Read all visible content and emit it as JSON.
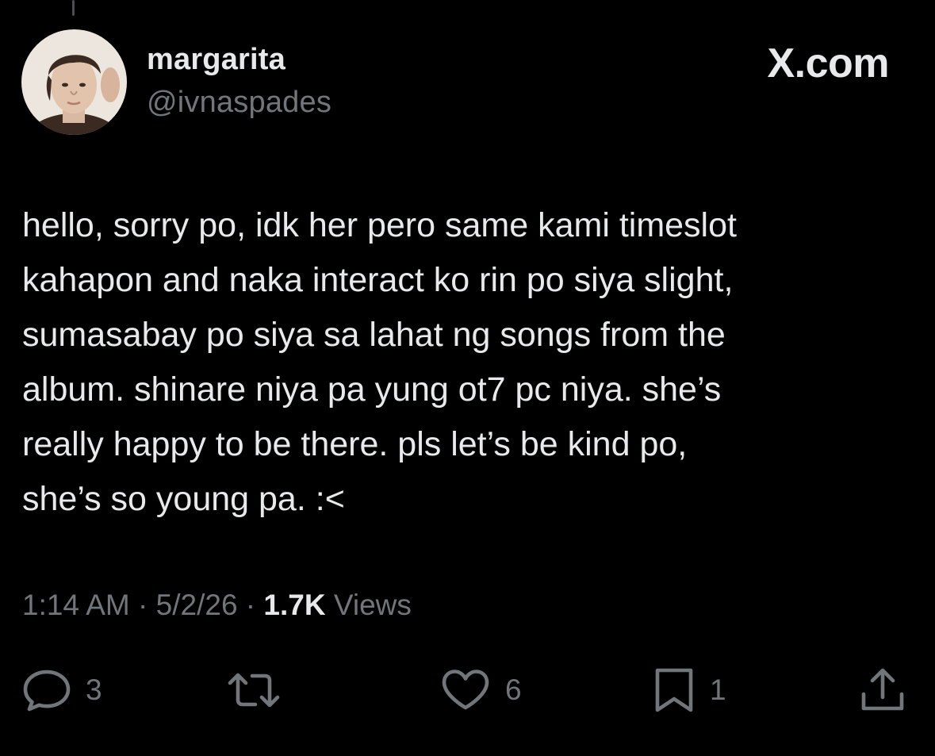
{
  "author": {
    "display_name": "margarita",
    "handle": "@ivnaspades"
  },
  "brand": "X.com",
  "tweet": {
    "lines": [
      "hello, sorry po, idk her pero same kami timeslot",
      "kahapon and naka interact ko rin po siya slight,",
      "sumasabay po siya sa lahat ng songs from the",
      "album. shinare niya pa yung ot7 pc niya. she’s",
      "really happy to be there. pls let’s be kind po,",
      "she’s so young pa. :<"
    ]
  },
  "meta": {
    "time": "1:14 AM",
    "sep1": " · ",
    "date": "5/2/26",
    "sep2": " · ",
    "views_count": "1.7K",
    "views_label": " Views"
  },
  "actions": {
    "replies": "3",
    "likes": "6",
    "bookmarks": "1"
  },
  "icons": {
    "reply": "speech-bubble-icon",
    "retweet": "retweet-arrows-icon",
    "like": "heart-icon",
    "bookmark": "bookmark-icon",
    "share": "share-upload-icon"
  },
  "colors": {
    "background": "#000000",
    "primary_text": "#e7e9ea",
    "secondary_text": "#71767b"
  }
}
